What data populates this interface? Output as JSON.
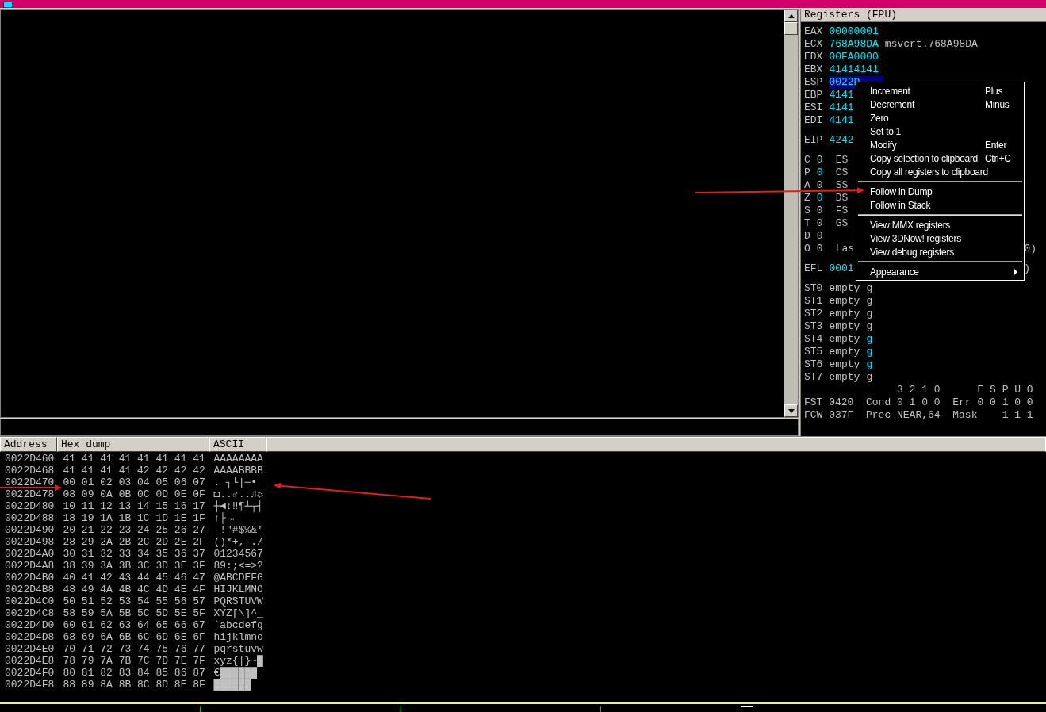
{
  "registers": {
    "title": "Registers (FPU)",
    "groups": [
      [
        {
          "kind": "register",
          "name": "EAX",
          "value": "00000001",
          "changed": true,
          "selected": false
        },
        {
          "kind": "register",
          "name": "ECX",
          "value": "768A98DA",
          "changed": true,
          "selected": false,
          "comment": "msvcrt.768A98DA"
        },
        {
          "kind": "register",
          "name": "EDX",
          "value": "00FA0000",
          "changed": true,
          "selected": false
        },
        {
          "kind": "register",
          "name": "EBX",
          "value": "41414141",
          "changed": true,
          "selected": false
        },
        {
          "kind": "register",
          "name": "ESP",
          "value": "0022D",
          "changed": true,
          "selected": true
        },
        {
          "kind": "register",
          "name": "EBP",
          "value": "4141",
          "changed": true,
          "selected": false
        },
        {
          "kind": "register",
          "name": "ESI",
          "value": "4141",
          "changed": true,
          "selected": false
        },
        {
          "kind": "register",
          "name": "EDI",
          "value": "4141",
          "changed": true,
          "selected": false
        }
      ],
      [
        {
          "kind": "register",
          "name": "EIP",
          "value": "4242",
          "changed": true,
          "selected": false
        }
      ],
      [
        {
          "kind": "flag",
          "name": "C",
          "value": "0",
          "changed": false,
          "segment": "ES"
        },
        {
          "kind": "flag",
          "name": "P",
          "value": "0",
          "changed": true,
          "segment": "CS"
        },
        {
          "kind": "flag",
          "name": "A",
          "value": "0",
          "changed": false,
          "segment": "SS"
        },
        {
          "kind": "flag",
          "name": "Z",
          "value": "0",
          "changed": true,
          "segment": "DS"
        },
        {
          "kind": "flag",
          "name": "S",
          "value": "0",
          "changed": false,
          "segment": "FS"
        },
        {
          "kind": "flag",
          "name": "T",
          "value": "0",
          "changed": false,
          "segment": "GS"
        },
        {
          "kind": "flag",
          "name": "D",
          "value": "0",
          "changed": false
        },
        {
          "kind": "flag",
          "name": "O",
          "value": "0",
          "changed": false,
          "segment": "Las",
          "tail": "0)"
        }
      ],
      [
        {
          "kind": "register",
          "name": "EFL",
          "value": "0001",
          "changed": true,
          "selected": false,
          "tail": ")"
        }
      ],
      [
        {
          "kind": "fpu",
          "name": "ST0",
          "value": "empty",
          "tag": "g",
          "changed": false
        },
        {
          "kind": "fpu",
          "name": "ST1",
          "value": "empty",
          "tag": "g",
          "changed": false
        },
        {
          "kind": "fpu",
          "name": "ST2",
          "value": "empty",
          "tag": "g",
          "changed": false
        },
        {
          "kind": "fpu",
          "name": "ST3",
          "value": "empty",
          "tag": "g",
          "changed": false
        },
        {
          "kind": "fpu",
          "name": "ST4",
          "value": "empty",
          "tag": "g",
          "changed": true
        },
        {
          "kind": "fpu",
          "name": "ST5",
          "value": "empty",
          "tag": "g",
          "changed": true
        },
        {
          "kind": "fpu",
          "name": "ST6",
          "value": "empty",
          "tag": "g",
          "changed": true
        },
        {
          "kind": "fpu",
          "name": "ST7",
          "value": "empty",
          "tag": "g",
          "changed": false
        },
        {
          "kind": "text",
          "text": "               3 2 1 0      E S P U O"
        },
        {
          "kind": "text",
          "text": "FST 0420  Cond 0 1 0 0  Err 0 0 1 0 0"
        },
        {
          "kind": "text",
          "text": "FCW 037F  Prec NEAR,64  Mask    1 1 1"
        }
      ]
    ]
  },
  "context_menu": [
    {
      "kind": "item",
      "label": "Increment",
      "shortcut": "Plus"
    },
    {
      "kind": "item",
      "label": "Decrement",
      "shortcut": "Minus"
    },
    {
      "kind": "item",
      "label": "Zero"
    },
    {
      "kind": "item",
      "label": "Set to 1"
    },
    {
      "kind": "item",
      "label": "Modify",
      "shortcut": "Enter"
    },
    {
      "kind": "item",
      "label": "Copy selection to clipboard",
      "shortcut": "Ctrl+C"
    },
    {
      "kind": "item",
      "label": "Copy all registers to clipboard"
    },
    {
      "kind": "separator"
    },
    {
      "kind": "item",
      "label": "Follow in Dump"
    },
    {
      "kind": "item",
      "label": "Follow in Stack"
    },
    {
      "kind": "separator"
    },
    {
      "kind": "item",
      "label": "View MMX registers"
    },
    {
      "kind": "item",
      "label": "View 3DNow! registers"
    },
    {
      "kind": "item",
      "label": "View debug registers"
    },
    {
      "kind": "separator"
    },
    {
      "kind": "submenu",
      "label": "Appearance"
    }
  ],
  "dump": {
    "columns": [
      "Address",
      "Hex dump",
      "ASCII"
    ],
    "rows": [
      {
        "address": "0022D460",
        "hex": "41 41 41 41 41 41 41 41",
        "ascii": "AAAAAAAA"
      },
      {
        "address": "0022D468",
        "hex": "41 41 41 41 42 42 42 42",
        "ascii": "AAAABBBB"
      },
      {
        "address": "0022D470",
        "hex": "00 01 02 03 04 05 06 07",
        "ascii": ". ┐└|─•"
      },
      {
        "address": "0022D478",
        "hex": "08 09 0A 0B 0C 0D 0E 0F",
        "ascii": "◘..♂..♫☼"
      },
      {
        "address": "0022D480",
        "hex": "10 11 12 13 14 15 16 17",
        "ascii": "┼◄↕‼¶┴┬┤"
      },
      {
        "address": "0022D488",
        "hex": "18 19 1A 1B 1C 1D 1E 1F",
        "ascii": "↑├→←"
      },
      {
        "address": "0022D490",
        "hex": "20 21 22 23 24 25 26 27",
        "ascii": " !\"#$%&'"
      },
      {
        "address": "0022D498",
        "hex": "28 29 2A 2B 2C 2D 2E 2F",
        "ascii": "()*+,-./"
      },
      {
        "address": "0022D4A0",
        "hex": "30 31 32 33 34 35 36 37",
        "ascii": "01234567"
      },
      {
        "address": "0022D4A8",
        "hex": "38 39 3A 3B 3C 3D 3E 3F",
        "ascii": "89:;<=>?"
      },
      {
        "address": "0022D4B0",
        "hex": "40 41 42 43 44 45 46 47",
        "ascii": "@ABCDEFG"
      },
      {
        "address": "0022D4B8",
        "hex": "48 49 4A 4B 4C 4D 4E 4F",
        "ascii": "HIJKLMNO"
      },
      {
        "address": "0022D4C0",
        "hex": "50 51 52 53 54 55 56 57",
        "ascii": "PQRSTUVW"
      },
      {
        "address": "0022D4C8",
        "hex": "58 59 5A 5B 5C 5D 5E 5F",
        "ascii": "XYZ[\\]^_"
      },
      {
        "address": "0022D4D0",
        "hex": "60 61 62 63 64 65 66 67",
        "ascii": "`abcdefg"
      },
      {
        "address": "0022D4D8",
        "hex": "68 69 6A 6B 6C 6D 6E 6F",
        "ascii": "hijklmno"
      },
      {
        "address": "0022D4E0",
        "hex": "70 71 72 73 74 75 76 77",
        "ascii": "pqrstuvw"
      },
      {
        "address": "0022D4E8",
        "hex": "78 79 7A 7B 7C 7D 7E 7F",
        "ascii": "xyz{|}~█"
      },
      {
        "address": "0022D4F0",
        "hex": "80 81 82 83 84 85 86 87",
        "ascii": "€██████"
      },
      {
        "address": "0022D4F8",
        "hex": "88 89 8A 8B 8C 8D 8E 8F",
        "ascii": "██████"
      }
    ]
  }
}
